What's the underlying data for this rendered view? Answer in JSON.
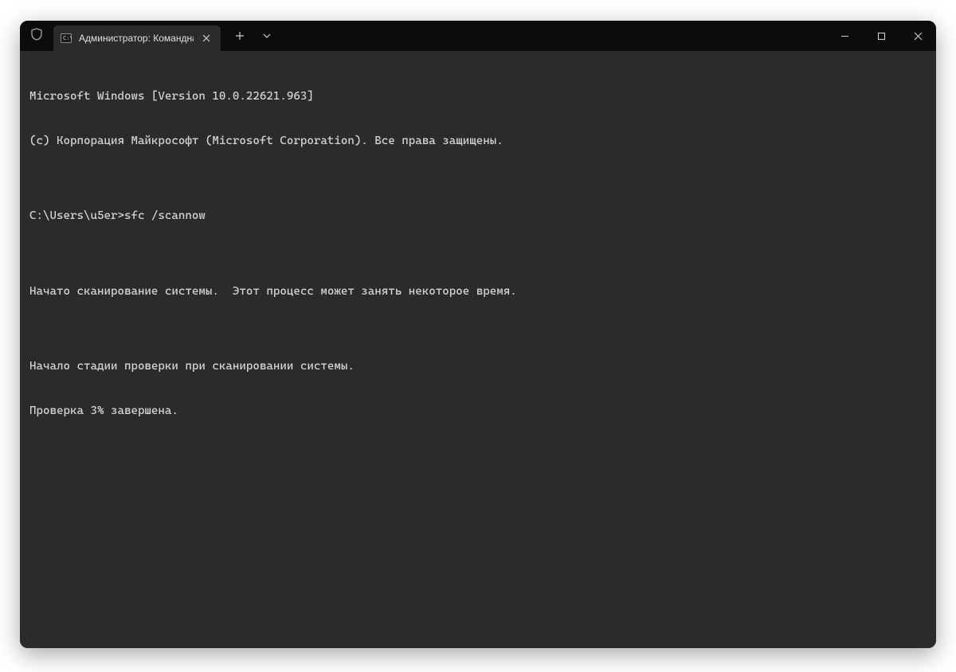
{
  "titlebar": {
    "tab": {
      "title": "Администратор: Командна"
    }
  },
  "terminal": {
    "lines": [
      "Microsoft Windows [Version 10.0.22621.963]",
      "(c) Корпорация Майкрософт (Microsoft Corporation). Все права защищены.",
      "",
      "C:\\Users\\u5er>sfc /scannow",
      "",
      "Начато сканирование системы.  Этот процесс может занять некоторое время.",
      "",
      "Начало стадии проверки при сканировании системы.",
      "Проверка 3% завершена."
    ]
  }
}
